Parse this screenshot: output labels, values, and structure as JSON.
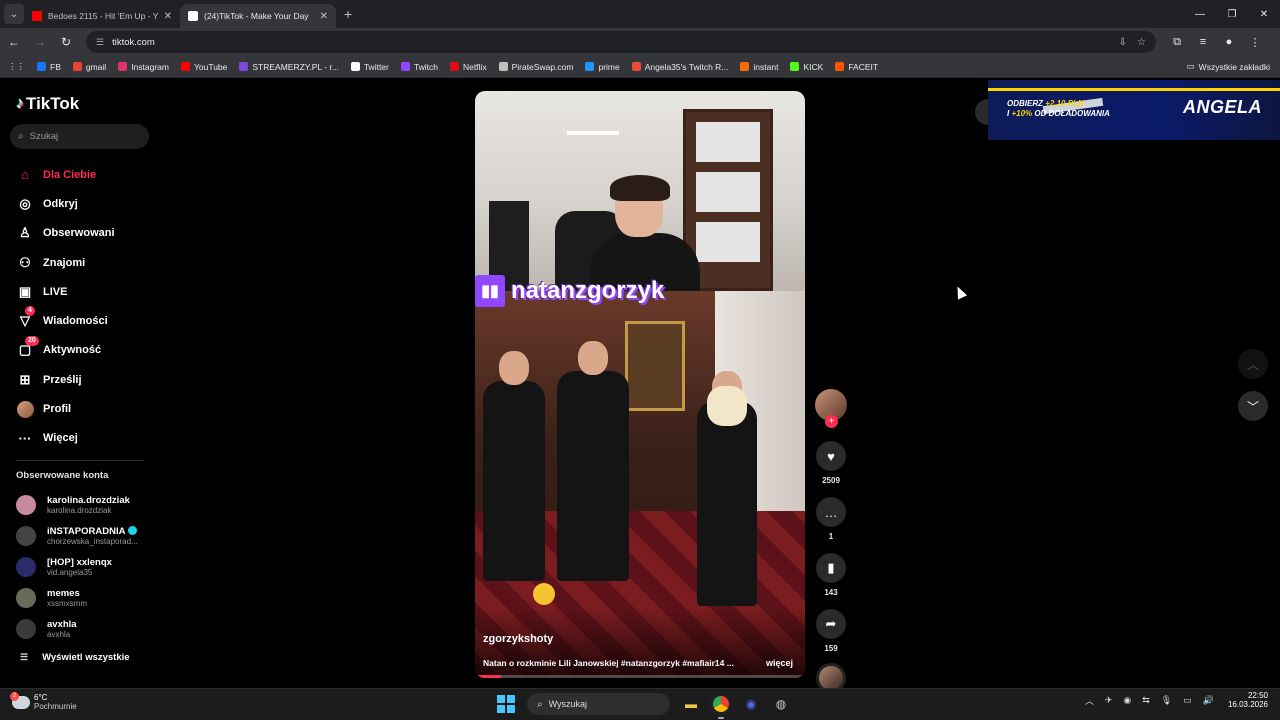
{
  "browser": {
    "tabs": [
      {
        "title": "Bedoes 2115 - Hit 'Em Up - YouTube",
        "favicon_color": "#ff0000",
        "active": false
      },
      {
        "title": "(24)TikTok - Make Your Day",
        "favicon_color": "#ffffff",
        "active": true
      }
    ],
    "new_tab": "+",
    "url": "tiktok.com",
    "bookmarks": [
      {
        "label": "FB",
        "color": "#1877f2"
      },
      {
        "label": "gmail",
        "color": "#ea4335"
      },
      {
        "label": "Instagram",
        "color": "#e1306c"
      },
      {
        "label": "YouTube",
        "color": "#ff0000"
      },
      {
        "label": "STREAMERZY.PL - r...",
        "color": "#7b4ad8"
      },
      {
        "label": "Twitter",
        "color": "#ffffff"
      },
      {
        "label": "Twitch",
        "color": "#9146ff"
      },
      {
        "label": "Netflix",
        "color": "#e50914"
      },
      {
        "label": "PirateSwap.com",
        "color": "#c0c0c0"
      },
      {
        "label": "prime",
        "color": "#1a98ff"
      },
      {
        "label": "Angela35's Twitch R...",
        "color": "#e84c3d"
      },
      {
        "label": "instant",
        "color": "#ff6a00"
      },
      {
        "label": "KICK",
        "color": "#53fc18"
      },
      {
        "label": "FACEIT",
        "color": "#ff5500"
      }
    ],
    "all_bookmarks": "Wszystkie zakładki"
  },
  "tiktok": {
    "logo": "TikTok",
    "search_placeholder": "Szukaj",
    "nav": [
      {
        "label": "Dla Ciebie",
        "icon": "home-icon",
        "glyph": "⌂",
        "active": true,
        "badge": ""
      },
      {
        "label": "Odkryj",
        "icon": "compass-icon",
        "glyph": "◎",
        "active": false,
        "badge": ""
      },
      {
        "label": "Obserwowani",
        "icon": "following-icon",
        "glyph": "♙",
        "active": false,
        "badge": ""
      },
      {
        "label": "Znajomi",
        "icon": "friends-icon",
        "glyph": "⚇",
        "active": false,
        "badge": ""
      },
      {
        "label": "LIVE",
        "icon": "live-icon",
        "glyph": "▣",
        "active": false,
        "badge": ""
      },
      {
        "label": "Wiadomości",
        "icon": "messages-icon",
        "glyph": "▽",
        "active": false,
        "badge": "4"
      },
      {
        "label": "Aktywność",
        "icon": "activity-icon",
        "glyph": "▢",
        "active": false,
        "badge": "20"
      },
      {
        "label": "Prześlij",
        "icon": "upload-icon",
        "glyph": "⊞",
        "active": false,
        "badge": ""
      },
      {
        "label": "Profil",
        "icon": "profile-avatar",
        "glyph": "",
        "active": false,
        "badge": ""
      },
      {
        "label": "Więcej",
        "icon": "more-icon",
        "glyph": "···",
        "active": false,
        "badge": ""
      }
    ],
    "following_title": "Obserwowane konta",
    "following": [
      {
        "name": "karolina.drozdziak",
        "user": "karolina.drozdziak",
        "verified": false,
        "color": "#c98aa0"
      },
      {
        "name": "iNSTAPORADNIA",
        "user": "chorzewska_instaporad...",
        "verified": true,
        "color": "#444444"
      },
      {
        "name": "[HOP] xxlenqx",
        "user": "vid.angela35",
        "verified": false,
        "color": "#2b2b6b"
      },
      {
        "name": "memes",
        "user": "xssmxsmm",
        "verified": false,
        "color": "#6a6a5a"
      },
      {
        "name": "avxhla",
        "user": "avxhla",
        "verified": false,
        "color": "#3a3a3a"
      }
    ],
    "see_all": "Wyświetl wszystkie",
    "video": {
      "overlay_handle": "natanzgorzyk",
      "author": "zgorzykshoty",
      "description": "Natan o rozkminie Lili Janowskiej #natanzgorzyk #mafiair14 ...",
      "more": "więcej",
      "progress": 0.08
    },
    "actions": {
      "likes": "2509",
      "comments": "1",
      "saves": "143",
      "shares": "159"
    }
  },
  "ad": {
    "line1_prefix": "ODBIERZ ",
    "line1_highlight": "+2.10 PLN",
    "line2_prefix": "I ",
    "line2_highlight": "+10%",
    "line2_suffix": " OD DOŁADOWANIA",
    "brand": "ANGELA"
  },
  "taskbar": {
    "temp": "6°C",
    "weather": "Pochmurnie",
    "weather_badge": "2",
    "search_placeholder": "Wyszukaj",
    "time": "22:50",
    "date": "16.03.2026"
  }
}
